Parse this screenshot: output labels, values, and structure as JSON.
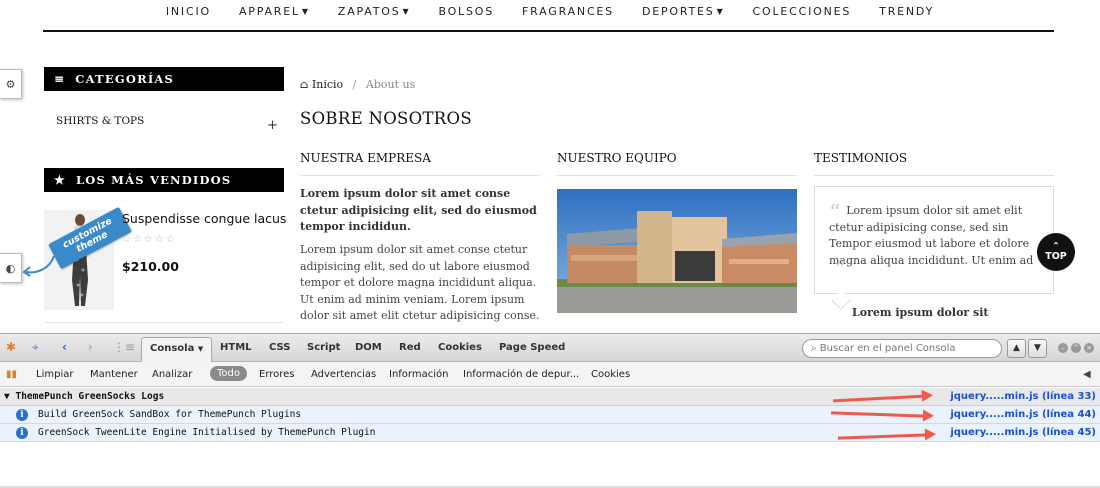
{
  "nav": {
    "items": [
      {
        "label": "INICIO",
        "caret": false
      },
      {
        "label": "APPAREL",
        "caret": true
      },
      {
        "label": "ZAPATOS",
        "caret": true
      },
      {
        "label": "BOLSOS",
        "caret": false
      },
      {
        "label": "FRAGRANCES",
        "caret": false
      },
      {
        "label": "DEPORTES",
        "caret": true
      },
      {
        "label": "COLECCIONES",
        "caret": false
      },
      {
        "label": "TRENDY",
        "caret": false
      }
    ]
  },
  "sidebar": {
    "categories_title": "CATEGORÍAS",
    "category_item": "SHIRTS & TOPS",
    "category_expand": "+",
    "bestsellers_title": "LOS MÁS VENDIDOS",
    "product": {
      "name": "Suspendisse congue lacus",
      "price": "$210.00",
      "rating": "0/5"
    },
    "customize_label": "customize theme"
  },
  "breadcrumb": {
    "home": "Inicio",
    "separator": "/",
    "current": "About us"
  },
  "page_title": "SOBRE NOSOTROS",
  "columns": {
    "empresa": {
      "title": "NUESTRA EMPRESA",
      "lead": "Lorem ipsum dolor sit amet conse ctetur adipisicing elit, sed do eiusmod tempor incididun.",
      "body": "Lorem ipsum dolor sit amet conse ctetur adipisicing elit, sed do ut labore eiusmod tempor et dolore magna incididunt aliqua. Ut enim ad minim veniam. Lorem ipsum dolor sit amet elit ctetur adipisicing conse."
    },
    "equipo": {
      "title": "NUESTRO EQUIPO"
    },
    "testimonios": {
      "title": "TESTIMONIOS",
      "quote": "Lorem ipsum dolor sit amet elit ctetur adipisicing conse, sed sin Tempor eiusmod ut labore et dolore magna aliqua incididunt. Ut enim ad",
      "author": "Lorem ipsum dolor sit"
    }
  },
  "top_button": "TOP",
  "devtools": {
    "tabs": [
      "Consola",
      "HTML",
      "CSS",
      "Script",
      "DOM",
      "Red",
      "Cookies",
      "Page Speed"
    ],
    "active_tab": "Consola",
    "search_placeholder": "Buscar en el panel Consola",
    "filter_actions": [
      "Limpiar",
      "Mantener",
      "Analizar"
    ],
    "filters": [
      "Todo",
      "Errores",
      "Advertencias",
      "Información",
      "Información de depur...",
      "Cookies"
    ],
    "active_filter": "Todo",
    "log_group": "ThemePunch GreenSocks Logs",
    "group_source": "jquery.....min.js (línea 33)",
    "logs": [
      {
        "message": "Build GreenSock SandBox for ThemePunch Plugins",
        "source": "jquery.....min.js (línea 44)"
      },
      {
        "message": "GreenSock TweenLite Engine Initialised by ThemePunch Plugin",
        "source": "jquery.....min.js (línea 45)"
      }
    ],
    "highlight_color": "#f05a4a"
  }
}
